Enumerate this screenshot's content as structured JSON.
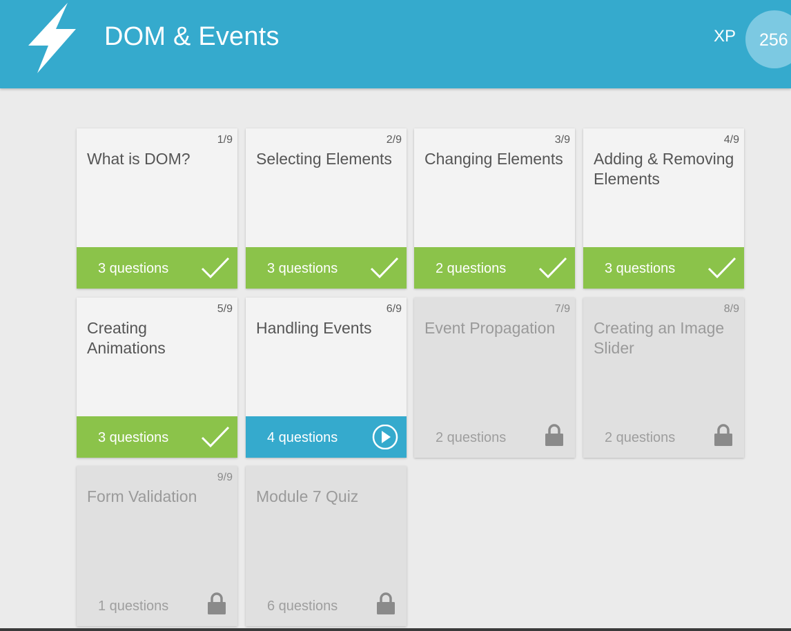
{
  "header": {
    "title": "DOM & Events",
    "logo_icon": "lightning-bolt-icon",
    "xp_label": "XP",
    "xp_value": "256"
  },
  "colors": {
    "header_bg": "#35aacd",
    "completed": "#8bc34a",
    "in_progress": "#35aacd",
    "locked_card": "#e0e0e0",
    "page_bg": "#ebebeb"
  },
  "lessons": [
    {
      "number": "1/9",
      "title": "What is DOM?",
      "questions": "3 questions",
      "status": "completed",
      "icon": "checkmark-icon"
    },
    {
      "number": "2/9",
      "title": "Selecting Elements",
      "questions": "3 questions",
      "status": "completed",
      "icon": "checkmark-icon"
    },
    {
      "number": "3/9",
      "title": "Changing Elements",
      "questions": "2 questions",
      "status": "completed",
      "icon": "checkmark-icon"
    },
    {
      "number": "4/9",
      "title": "Adding & Removing Elements",
      "questions": "3 questions",
      "status": "completed",
      "icon": "checkmark-icon"
    },
    {
      "number": "5/9",
      "title": "Creating Animations",
      "questions": "3 questions",
      "status": "completed",
      "icon": "checkmark-icon"
    },
    {
      "number": "6/9",
      "title": "Handling Events",
      "questions": "4 questions",
      "status": "in-progress",
      "icon": "play-icon"
    },
    {
      "number": "7/9",
      "title": "Event Propagation",
      "questions": "2 questions",
      "status": "locked",
      "icon": "lock-icon"
    },
    {
      "number": "8/9",
      "title": "Creating an Image Slider",
      "questions": "2 questions",
      "status": "locked",
      "icon": "lock-icon"
    },
    {
      "number": "9/9",
      "title": "Form Validation",
      "questions": "1 questions",
      "status": "locked",
      "icon": "lock-icon"
    },
    {
      "number": "",
      "title": "Module 7 Quiz",
      "questions": "6 questions",
      "status": "locked",
      "icon": "lock-icon"
    }
  ]
}
